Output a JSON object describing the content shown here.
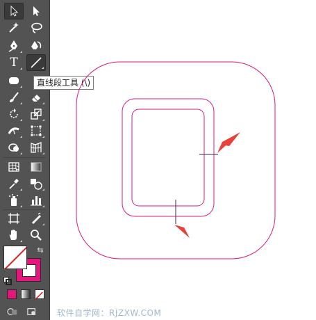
{
  "toolbar": {
    "tools": [
      {
        "id": "selection",
        "icon": "selection-arrow-icon"
      },
      {
        "id": "direct-selection",
        "icon": "direct-selection-arrow-icon"
      },
      {
        "id": "magic-wand",
        "icon": "magic-wand-icon"
      },
      {
        "id": "lasso",
        "icon": "lasso-icon"
      },
      {
        "id": "pen",
        "icon": "pen-icon"
      },
      {
        "id": "curvature",
        "icon": "curvature-pen-icon"
      },
      {
        "id": "type",
        "icon": "type-icon",
        "glyph": "T"
      },
      {
        "id": "line-segment",
        "icon": "line-segment-icon",
        "active": true
      },
      {
        "id": "rectangle",
        "icon": "rounded-rectangle-icon"
      },
      {
        "id": "paintbrush",
        "icon": "paintbrush-icon"
      },
      {
        "id": "pencil",
        "icon": "pencil-icon"
      },
      {
        "id": "eraser",
        "icon": "eraser-icon"
      },
      {
        "id": "rotate",
        "icon": "rotate-icon"
      },
      {
        "id": "scale",
        "icon": "scale-icon"
      },
      {
        "id": "width",
        "icon": "width-icon"
      },
      {
        "id": "free-transform",
        "icon": "free-transform-icon"
      },
      {
        "id": "shape-builder",
        "icon": "shape-builder-icon"
      },
      {
        "id": "perspective-grid",
        "icon": "perspective-grid-icon"
      },
      {
        "id": "mesh",
        "icon": "mesh-icon"
      },
      {
        "id": "gradient",
        "icon": "gradient-icon"
      },
      {
        "id": "eyedropper",
        "icon": "eyedropper-icon"
      },
      {
        "id": "blend",
        "icon": "blend-icon"
      },
      {
        "id": "symbol-sprayer",
        "icon": "symbol-sprayer-icon"
      },
      {
        "id": "column-graph",
        "icon": "column-graph-icon"
      },
      {
        "id": "artboard",
        "icon": "artboard-icon"
      },
      {
        "id": "slice",
        "icon": "slice-icon"
      },
      {
        "id": "hand",
        "icon": "hand-icon"
      },
      {
        "id": "zoom",
        "icon": "zoom-icon"
      }
    ],
    "tooltip": "直线段工具 (\\)",
    "swap_glyph": "⇆"
  },
  "colors": {
    "toolbar_bg": "#535353",
    "stroke": "#e5167b",
    "fill": "none",
    "arrow": "#e8403a",
    "artwork_line": "#d81b7d"
  },
  "watermark": "软件自学网：RJZXW.COM"
}
